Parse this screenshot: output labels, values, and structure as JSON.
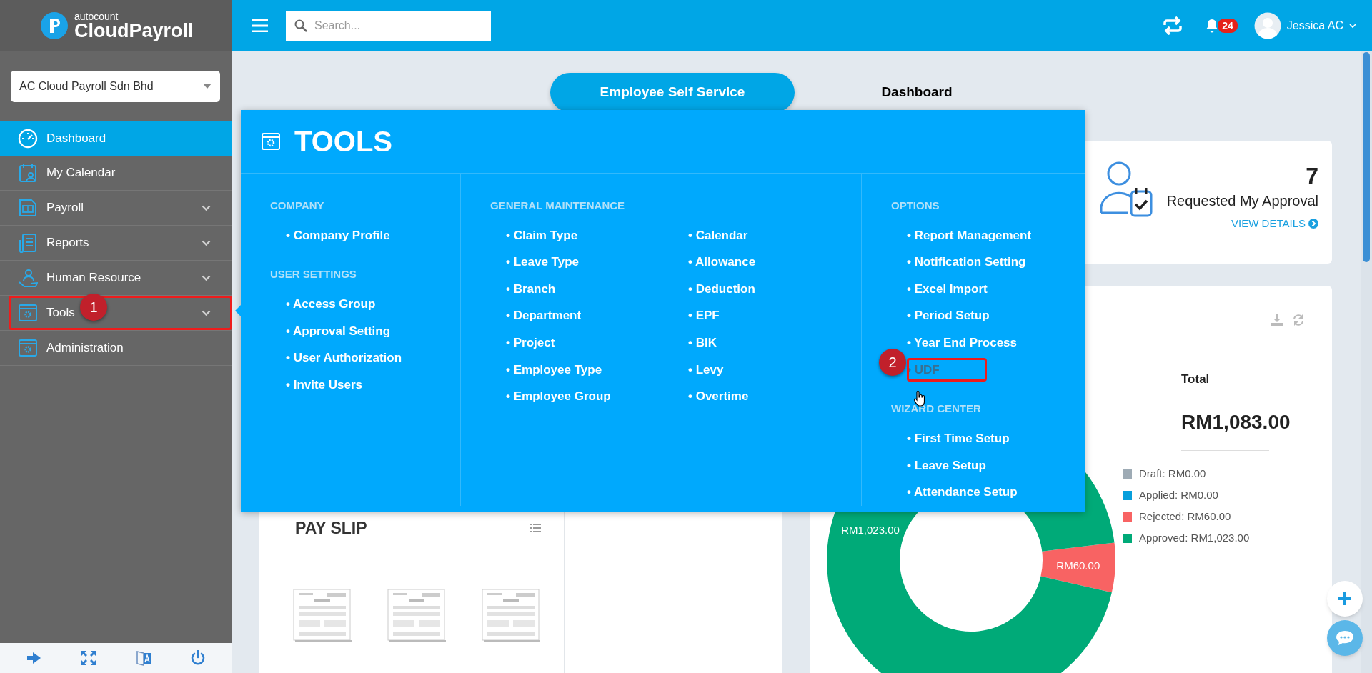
{
  "brand": {
    "small": "autocount",
    "name": "CloudPayroll"
  },
  "company_select": {
    "value": "AC Cloud Payroll Sdn Bhd"
  },
  "sidebar": {
    "items": [
      {
        "label": "Dashboard",
        "selected": true,
        "expandable": false
      },
      {
        "label": "My Calendar",
        "selected": false,
        "expandable": false
      },
      {
        "label": "Payroll",
        "selected": false,
        "expandable": true
      },
      {
        "label": "Reports",
        "selected": false,
        "expandable": true
      },
      {
        "label": "Human Resource",
        "selected": false,
        "expandable": true
      },
      {
        "label": "Tools",
        "selected": false,
        "expandable": true
      },
      {
        "label": "Administration",
        "selected": false,
        "expandable": false
      }
    ]
  },
  "header": {
    "search": {
      "placeholder": "Search..."
    },
    "notifications": "24",
    "user": "Jessica AC"
  },
  "tabs": [
    {
      "label": "Employee Self Service",
      "selected": true
    },
    {
      "label": "Dashboard",
      "selected": false
    }
  ],
  "approval_card": {
    "count": "7",
    "label": "Requested My Approval",
    "link": "VIEW DETAILS"
  },
  "claims_card": {
    "total_label": "Total",
    "total": "RM1,083.00",
    "legend": [
      {
        "label": "Draft: RM0.00",
        "color": "#9eabb5"
      },
      {
        "label": "Applied: RM0.00",
        "color": "#079fdc"
      },
      {
        "label": "Rejected: RM60.00",
        "color": "#f86363"
      },
      {
        "label": "Approved: RM1,023.00",
        "color": "#00aa78"
      }
    ],
    "chart_data": {
      "type": "donut",
      "values": [
        0,
        0,
        60,
        1023
      ],
      "value_labels": [
        null,
        null,
        "RM60.00",
        "RM1,023.00"
      ]
    }
  },
  "payslip_card": {
    "title": "PAY SLIP"
  },
  "tools_menu": {
    "title": "TOOLS",
    "columns": [
      {
        "groups": [
          {
            "heading": "COMPANY",
            "items": [
              {
                "label": "• Company Profile",
                "highlighted": false
              }
            ]
          },
          {
            "heading": "USER SETTINGS",
            "items": [
              {
                "label": "• Access Group",
                "highlighted": false
              },
              {
                "label": "• Approval Setting",
                "highlighted": false
              },
              {
                "label": "• User Authorization",
                "highlighted": false
              },
              {
                "label": "• Invite Users",
                "highlighted": false
              }
            ]
          }
        ]
      },
      {
        "groups": [
          {
            "heading": "GENERAL MAINTENANCE",
            "items": [
              {
                "label": "• Claim Type",
                "highlighted": false
              },
              {
                "label": "• Leave Type",
                "highlighted": false
              },
              {
                "label": "• Branch",
                "highlighted": false
              },
              {
                "label": "• Department",
                "highlighted": false
              },
              {
                "label": "• Project",
                "highlighted": false
              },
              {
                "label": "• Employee Type",
                "highlighted": false
              },
              {
                "label": "• Employee Group",
                "highlighted": false
              },
              {
                "label": "• Calendar",
                "highlighted": false
              },
              {
                "label": "• Allowance",
                "highlighted": false
              },
              {
                "label": "• Deduction",
                "highlighted": false
              },
              {
                "label": "• EPF",
                "highlighted": false
              },
              {
                "label": "• BIK",
                "highlighted": false
              },
              {
                "label": "• Levy",
                "highlighted": false
              },
              {
                "label": "• Overtime",
                "highlighted": false
              }
            ]
          }
        ]
      },
      {
        "groups": [
          {
            "heading": "OPTIONS",
            "items": [
              {
                "label": "• Report Management",
                "highlighted": false
              },
              {
                "label": "• Notification Setting",
                "highlighted": false
              },
              {
                "label": "• Excel Import",
                "highlighted": false
              },
              {
                "label": "• Period Setup",
                "highlighted": false
              },
              {
                "label": "• Year End Process",
                "highlighted": false
              },
              {
                "label": "• UDF",
                "highlighted": true
              }
            ]
          },
          {
            "heading": "WIZARD CENTER",
            "items": [
              {
                "label": "• First Time Setup",
                "highlighted": false
              },
              {
                "label": "• Leave Setup",
                "highlighted": false
              },
              {
                "label": "• Attendance Setup",
                "highlighted": false
              }
            ]
          }
        ]
      }
    ]
  },
  "annotations": [
    {
      "number": "1"
    },
    {
      "number": "2"
    }
  ]
}
